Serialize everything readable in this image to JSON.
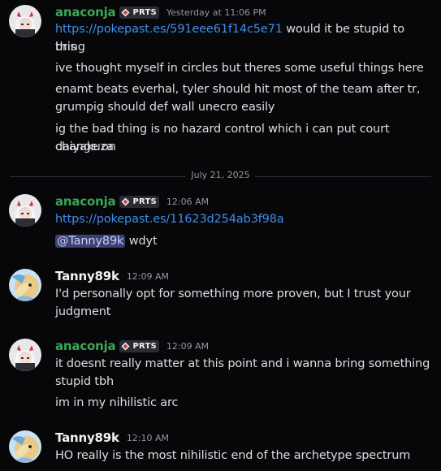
{
  "messages": [
    {
      "author": "anaconja",
      "tag": "PRTS",
      "time": "Yesterday at 11:06 PM",
      "link": "https://pokepast.es/591eee61f14c5e71",
      "line1_rest": " would it be stupid to bring",
      "line1_cont": "this",
      "line2": "ive thought myself in circles but theres some useful things here",
      "line3a": "enamt beats everhal, tyler should hit most of the team after tr,",
      "line3b": "grumpig should def wall unecro easily",
      "line4a": "ig the bad thing is no hazard control which i can put court change on",
      "line4b": "daiyakuza"
    },
    {
      "author": "anaconja",
      "tag": "PRTS",
      "time": "12:06 AM",
      "link": "https://pokepast.es/11623d254ab3f98a",
      "mention": "@Tanny89k",
      "mention_rest": " wdyt"
    },
    {
      "author": "Tanny89k",
      "time": "12:09 AM",
      "line1": "I'd personally opt for something more proven, but I trust your",
      "line2": "judgment"
    },
    {
      "author": "anaconja",
      "tag": "PRTS",
      "time": "12:09 AM",
      "line1": "it doesnt really matter at this point and i wanna bring something",
      "line2": "stupid tbh",
      "line3": "im in my nihilistic arc"
    },
    {
      "author": "Tanny89k",
      "time": "12:10 AM",
      "line1": "HO really is the most nihilistic end of the archetype spectrum"
    }
  ],
  "divider": "July 21, 2025",
  "colors": {
    "background": "#070709",
    "anaconja_name": "#3aa856",
    "link": "#3f8ee9",
    "mention_bg": "#3c4270"
  }
}
